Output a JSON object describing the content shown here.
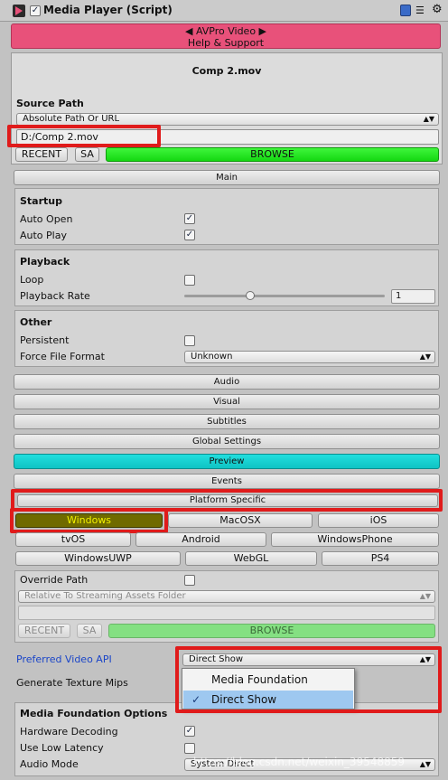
{
  "header": {
    "title": "Media Player (Script)"
  },
  "banner": {
    "line1": "◀ AVPro Video ▶",
    "line2": "Help & Support"
  },
  "file": {
    "name": "Comp 2.mov"
  },
  "source": {
    "heading": "Source Path",
    "mode": "Absolute Path Or URL",
    "path": "D:/Comp 2.mov",
    "recent": "RECENT",
    "sa": "SA",
    "browse": "BROWSE"
  },
  "main_label": "Main",
  "startup": {
    "heading": "Startup",
    "auto_open": "Auto Open",
    "auto_play": "Auto Play"
  },
  "playback": {
    "heading": "Playback",
    "loop": "Loop",
    "rate_label": "Playback Rate",
    "rate_value": "1",
    "rate_fraction": 0.33
  },
  "other": {
    "heading": "Other",
    "persistent": "Persistent",
    "force_format": "Force File Format",
    "format_value": "Unknown"
  },
  "sections": {
    "audio": "Audio",
    "visual": "Visual",
    "subtitles": "Subtitles",
    "global": "Global Settings",
    "preview": "Preview",
    "events": "Events",
    "platform": "Platform Specific"
  },
  "platforms": {
    "windows": "Windows",
    "macosx": "MacOSX",
    "ios": "iOS",
    "tvos": "tvOS",
    "android": "Android",
    "windowsphone": "WindowsPhone",
    "windowsuwp": "WindowsUWP",
    "webgl": "WebGL",
    "ps4": "PS4"
  },
  "override": {
    "label": "Override Path",
    "mode": "Relative To Streaming Assets Folder",
    "recent": "RECENT",
    "sa": "SA",
    "browse": "BROWSE"
  },
  "api": {
    "label": "Preferred Video API",
    "value": "Direct Show",
    "options": [
      "Media Foundation",
      "Direct Show"
    ]
  },
  "texture_mips": "Generate Texture Mips",
  "mf_options": {
    "heading": "Media Foundation Options",
    "hw_decoding": "Hardware Decoding",
    "low_latency": "Use Low Latency",
    "audio_mode": "Audio Mode",
    "audio_value": "System Direct"
  },
  "watermark": "https://blog.csdn.net/weixin_39548859",
  "colors": {
    "banner": "#e8517a",
    "browse": "#1ee01a",
    "preview": "#12cccc",
    "windows_tab": "#6f6a00",
    "windows_text": "#f2f200",
    "highlight": "#e01b1b",
    "link_blue": "#1a45c8",
    "selected_item": "#9ec8f0"
  }
}
